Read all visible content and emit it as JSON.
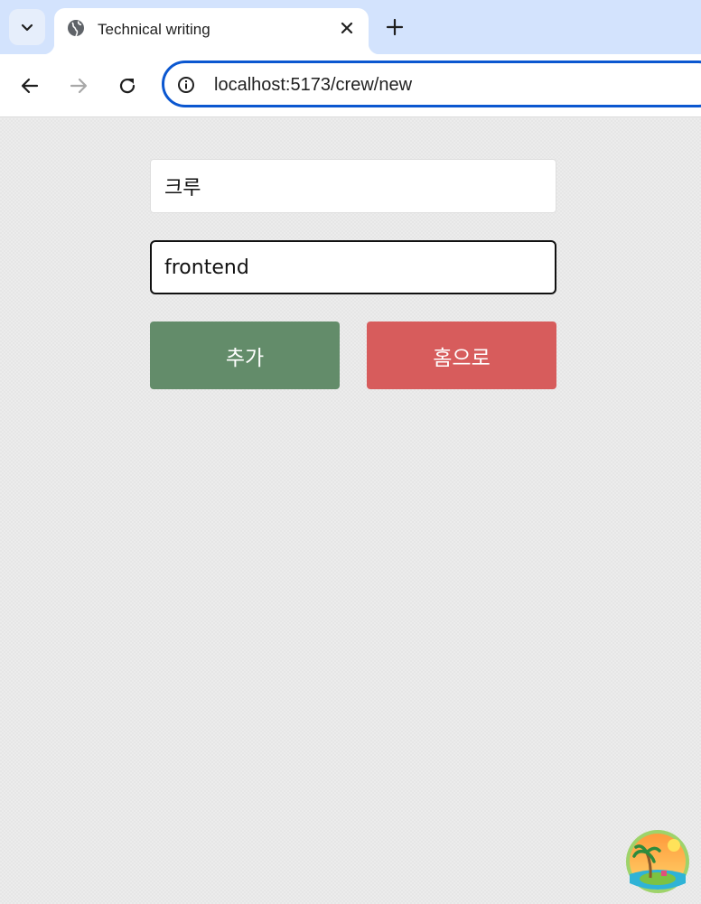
{
  "browser": {
    "tab": {
      "title": "Technical writing"
    },
    "address_bar": {
      "url": "localhost:5173/crew/new"
    },
    "icons": {
      "tab_search": "chevron-down-icon",
      "favicon": "globe-icon",
      "close": "close-icon",
      "new_tab": "plus-icon",
      "back": "arrow-left-icon",
      "forward": "arrow-right-icon",
      "reload": "reload-icon",
      "site_info": "info-icon"
    }
  },
  "form": {
    "name_field": {
      "value": "크루"
    },
    "role_field": {
      "value": "frontend"
    },
    "add_button": {
      "label": "추가",
      "color": "#638c6a"
    },
    "home_button": {
      "label": "홈으로",
      "color": "#d75c5c"
    }
  },
  "colors": {
    "tabstrip_bg": "#d3e3fd",
    "omnibox_border": "#0b57d0",
    "page_bg": "#ececec"
  }
}
